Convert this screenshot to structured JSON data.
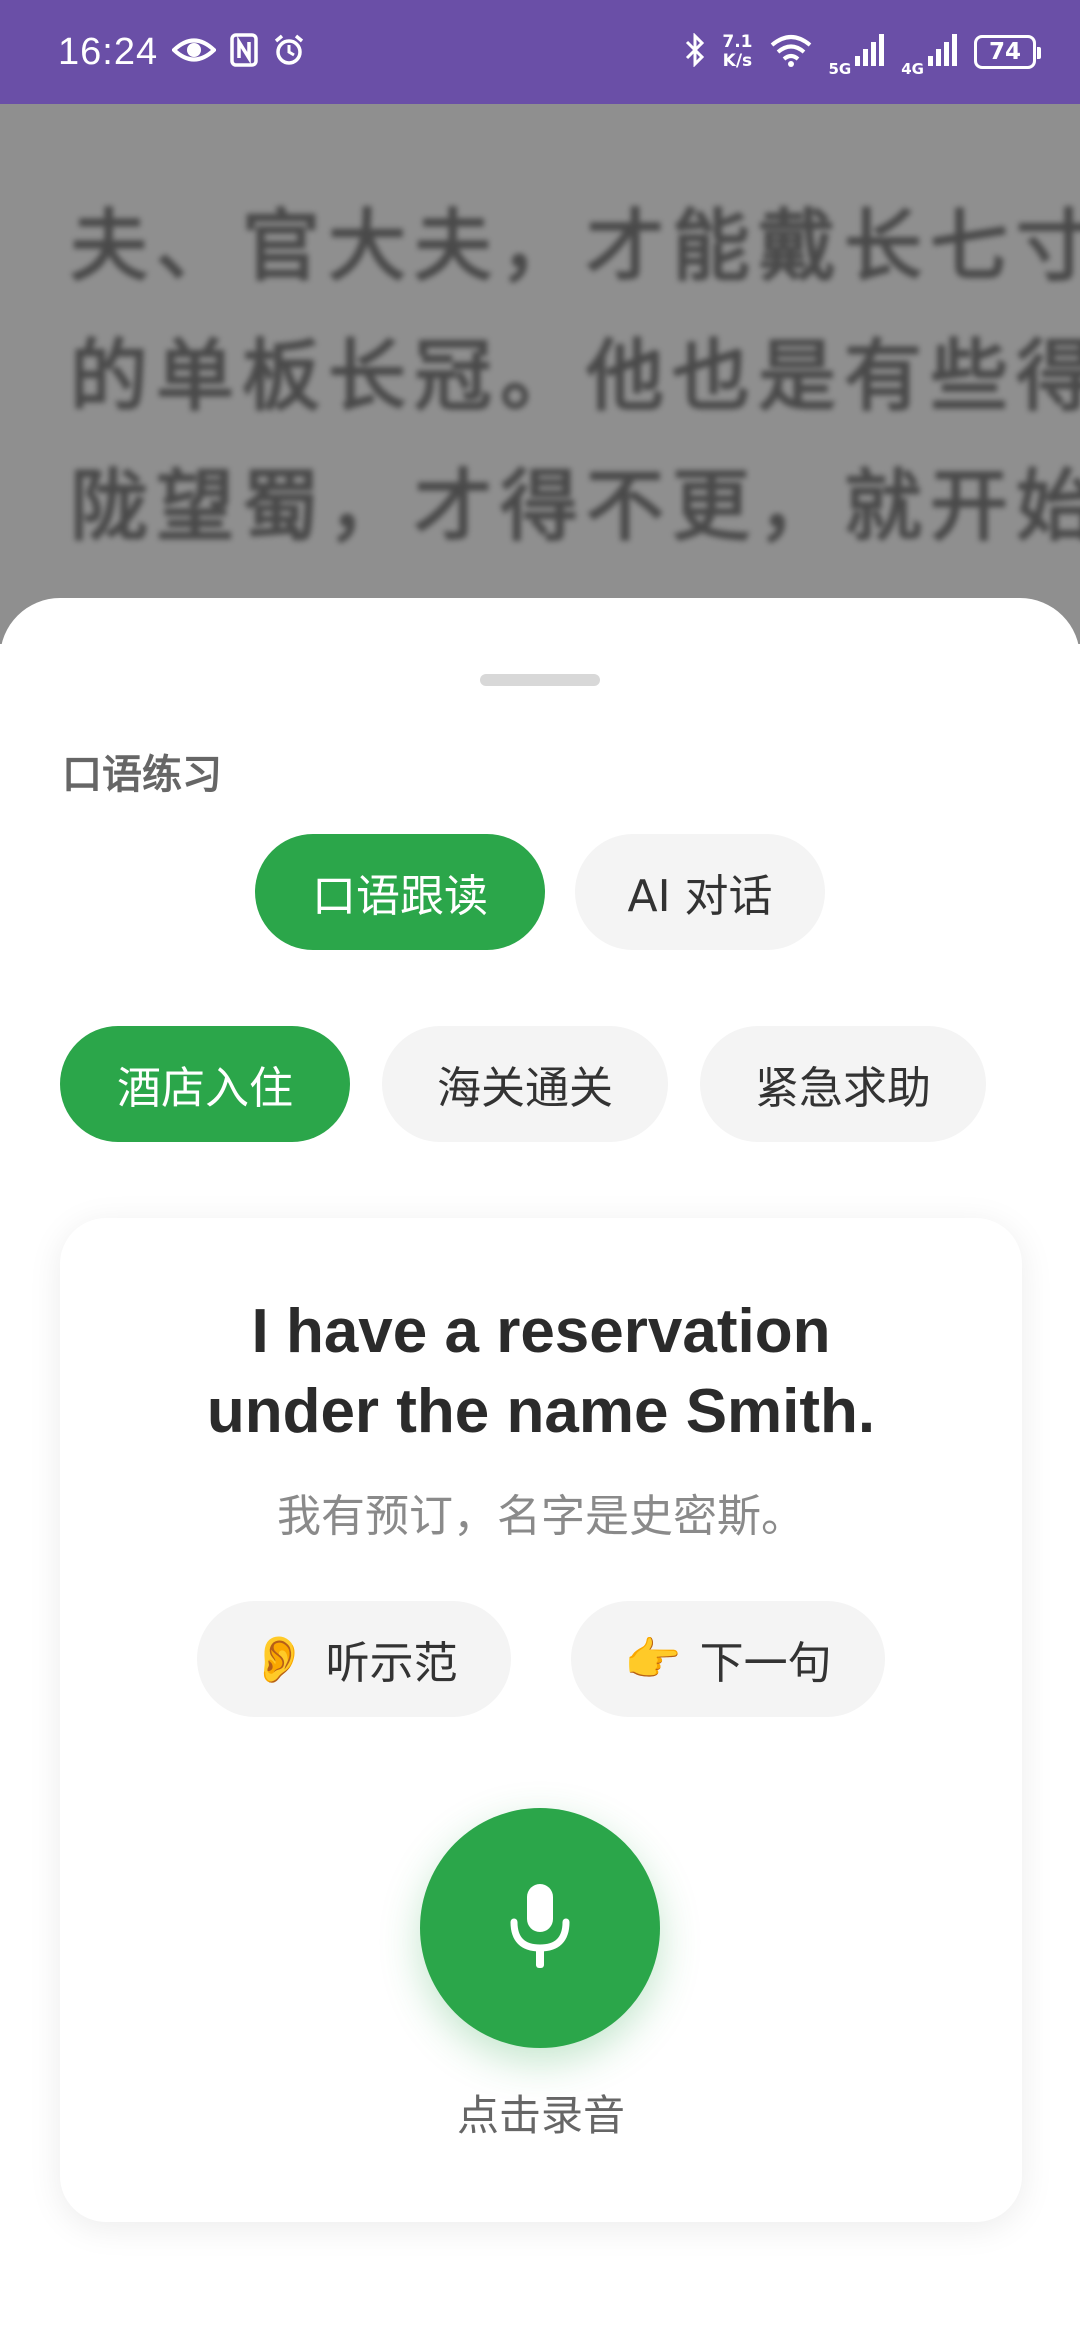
{
  "status_bar": {
    "time": "16:24",
    "net_speed_value": "7.1",
    "net_speed_unit": "K/s",
    "network_5g": "5G",
    "network_4g": "4G",
    "battery": "74",
    "bg_color": "#6a4fa7"
  },
  "reader": {
    "lines": [
      "夫、官大夫，才能戴长七寸",
      "的单板长冠。他也是有些得",
      "陇望蜀，才得不更，就开始"
    ]
  },
  "sheet": {
    "title": "口语练习",
    "mode_tabs": [
      {
        "label": "口语跟读",
        "active": true
      },
      {
        "label": "AI 对话",
        "active": false
      }
    ],
    "scene_tabs": [
      {
        "label": "酒店入住",
        "active": true
      },
      {
        "label": "海关通关",
        "active": false
      },
      {
        "label": "紧急求助",
        "active": false
      }
    ],
    "card": {
      "sentence_en_line1": "I have a reservation",
      "sentence_en_line2": "under the name Smith.",
      "sentence_zh": "我有预订，名字是史密斯。",
      "listen_icon": "👂",
      "listen_label": "听示范",
      "next_icon": "👉",
      "next_label": "下一句",
      "mic_icon": "microphone-icon",
      "record_label": "点击录音"
    },
    "accent_color": "#2ba64a"
  }
}
